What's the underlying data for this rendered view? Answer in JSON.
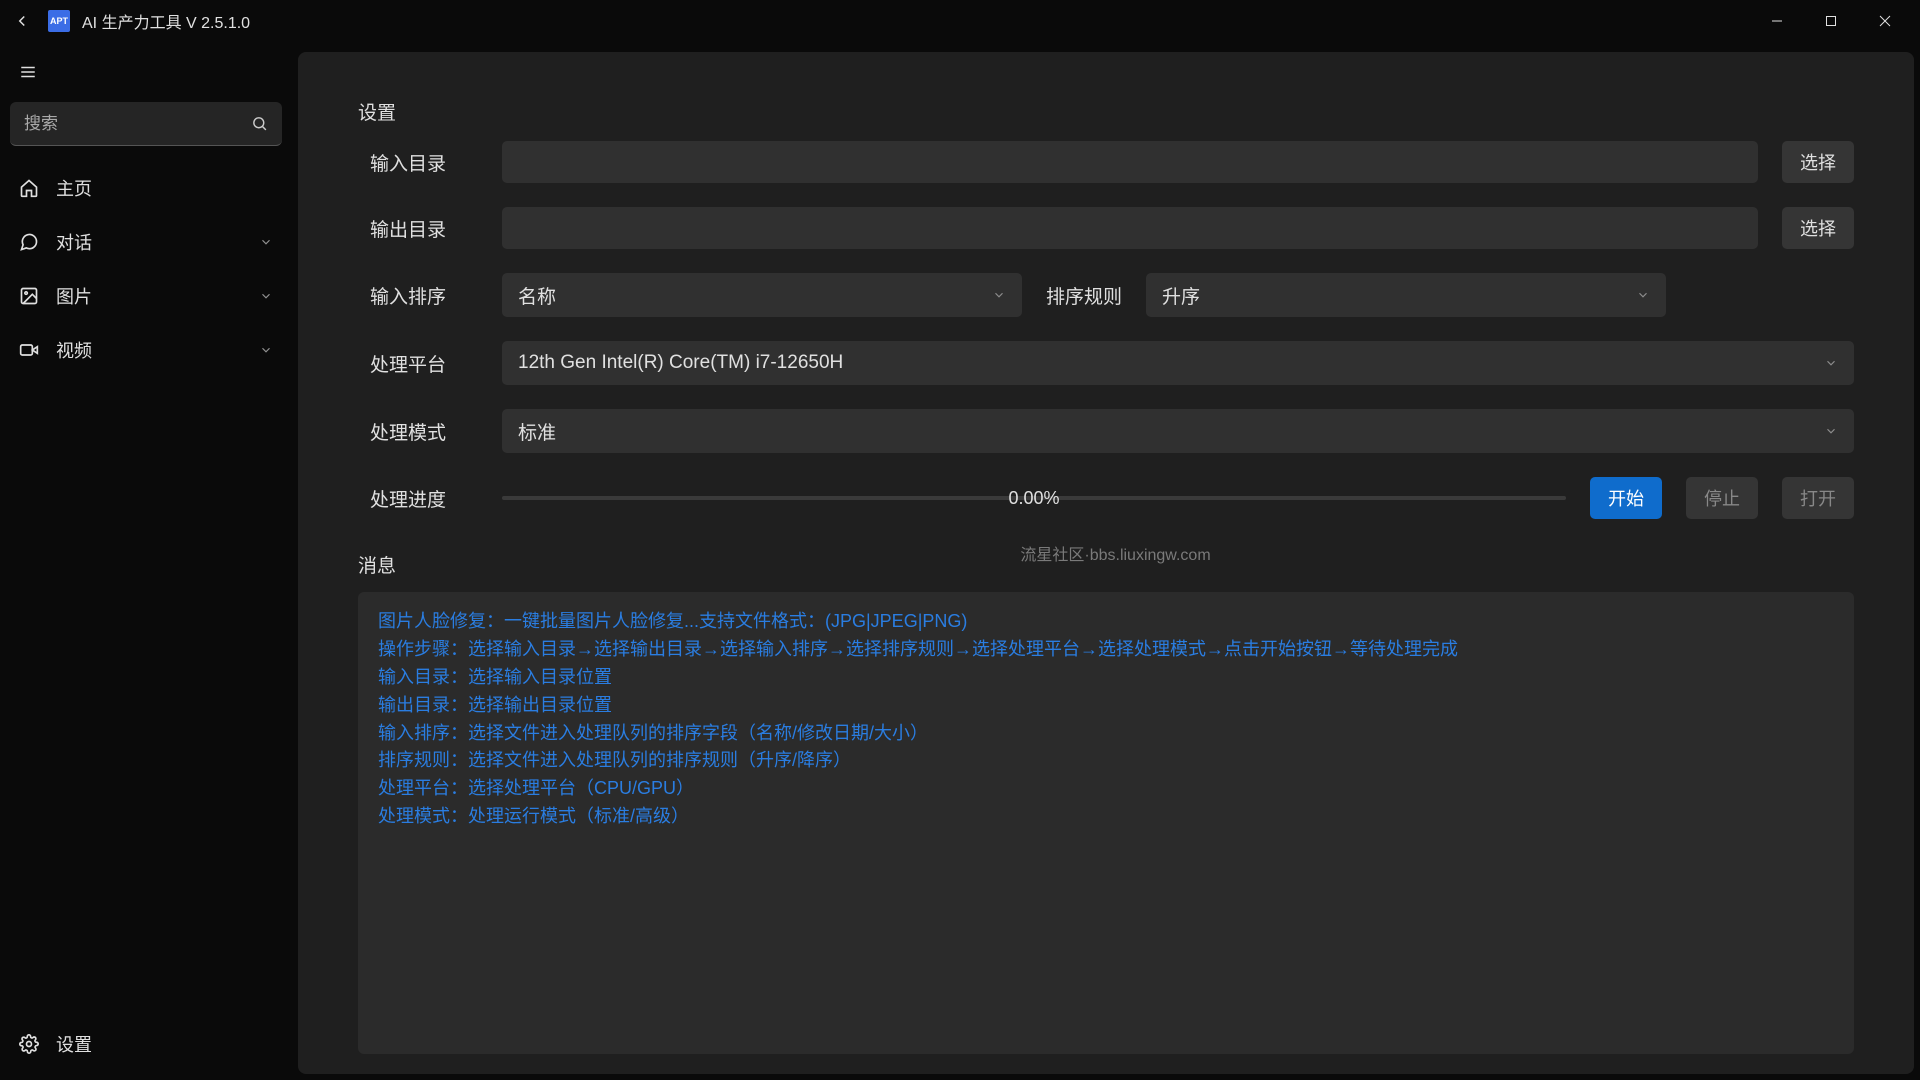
{
  "titlebar": {
    "back_icon": "back",
    "app_badge": "APT",
    "title": "AI 生产力工具 V 2.5.1.0"
  },
  "sidebar": {
    "search_placeholder": "搜索",
    "items": [
      {
        "icon": "home",
        "label": "主页",
        "expandable": false
      },
      {
        "icon": "chat",
        "label": "对话",
        "expandable": true
      },
      {
        "icon": "image",
        "label": "图片",
        "expandable": true
      },
      {
        "icon": "video",
        "label": "视频",
        "expandable": true
      }
    ],
    "footer": {
      "icon": "gear",
      "label": "设置"
    }
  },
  "settings": {
    "heading": "设置",
    "rows": {
      "input_dir": {
        "label": "输入目录",
        "value": "",
        "button": "选择"
      },
      "output_dir": {
        "label": "输出目录",
        "value": "",
        "button": "选择"
      },
      "sort_field": {
        "label": "输入排序",
        "value": "名称"
      },
      "sort_rule": {
        "label": "排序规则",
        "value": "升序"
      },
      "platform": {
        "label": "处理平台",
        "value": "12th Gen Intel(R) Core(TM) i7-12650H"
      },
      "mode": {
        "label": "处理模式",
        "value": "标准"
      },
      "progress": {
        "label": "处理进度",
        "percent": "0.00%"
      }
    },
    "actions": {
      "start": "开始",
      "stop": "停止",
      "open": "打开"
    }
  },
  "watermark": "流星社区·bbs.liuxingw.com",
  "messages": {
    "heading": "消息",
    "lines": [
      "图片人脸修复：一键批量图片人脸修复...支持文件格式：(JPG|JPEG|PNG)",
      "操作步骤：选择输入目录→选择输出目录→选择输入排序→选择排序规则→选择处理平台→选择处理模式→点击开始按钮→等待处理完成",
      "输入目录：选择输入目录位置",
      "输出目录：选择输出目录位置",
      "输入排序：选择文件进入处理队列的排序字段（名称/修改日期/大小）",
      "排序规则：选择文件进入处理队列的排序规则（升序/降序）",
      "处理平台：选择处理平台（CPU/GPU）",
      "处理模式：处理运行模式（标准/高级）"
    ]
  }
}
